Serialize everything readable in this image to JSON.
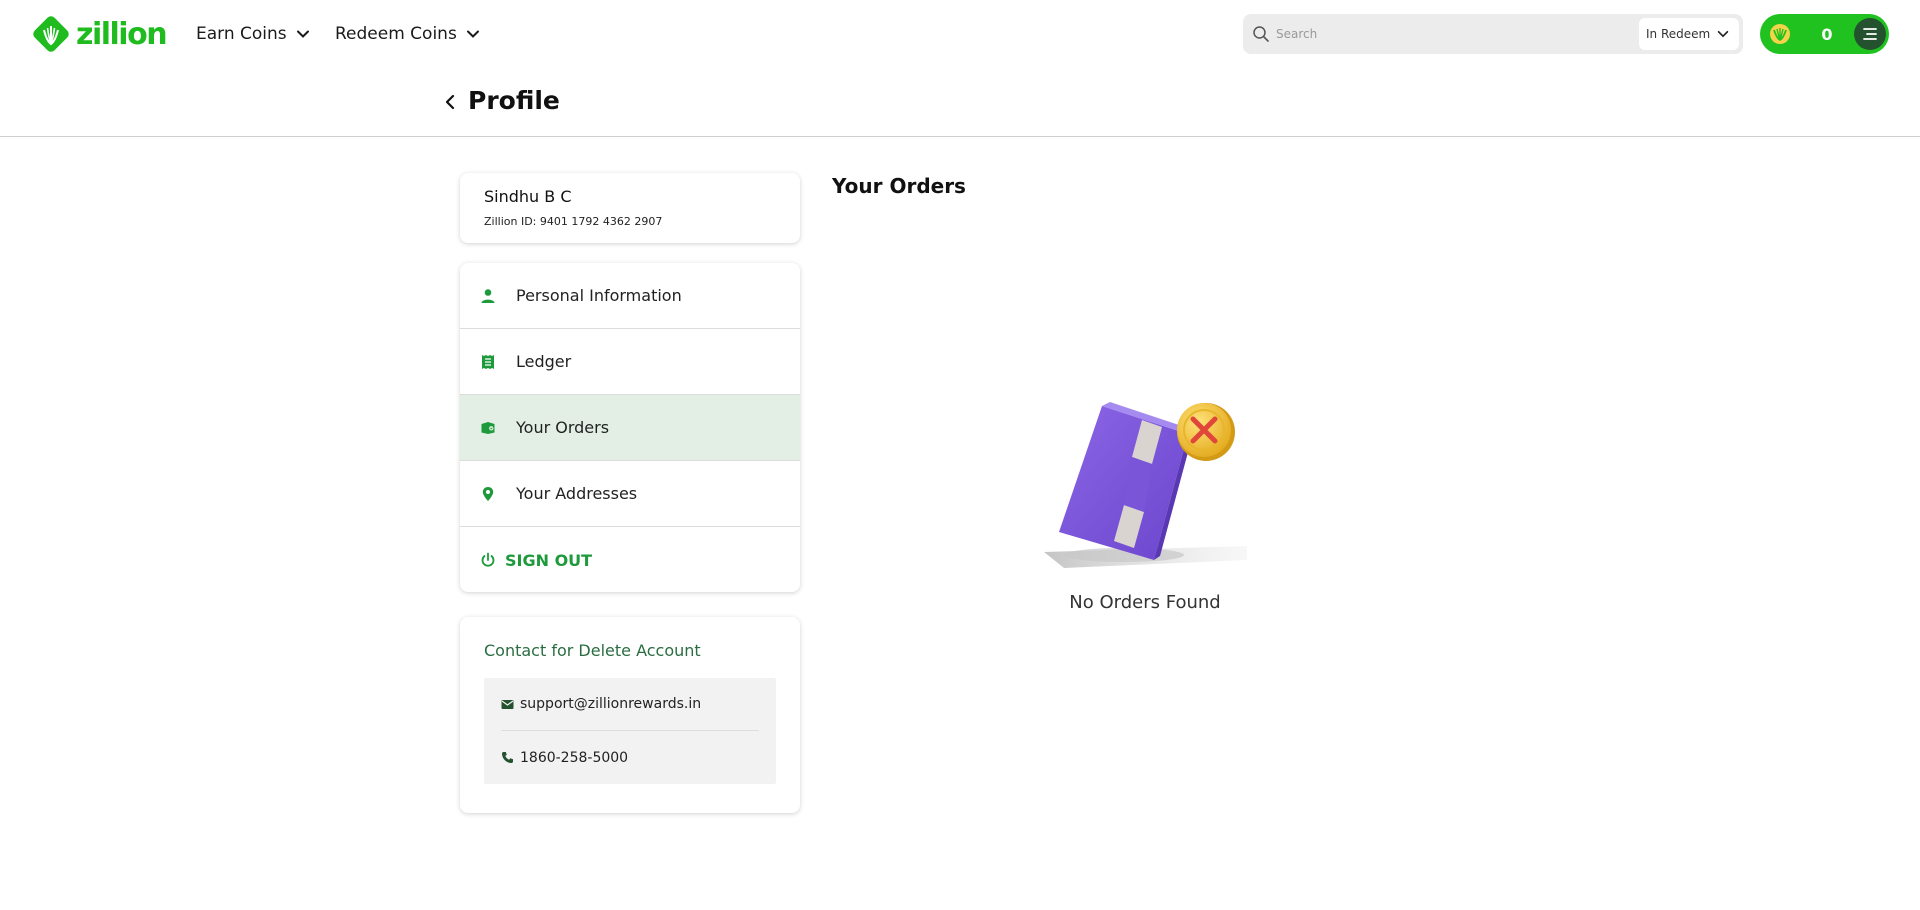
{
  "brand": {
    "name": "zillion",
    "color": "#1fbb1f"
  },
  "nav": {
    "earn_label": "Earn Coins",
    "redeem_label": "Redeem Coins"
  },
  "search": {
    "placeholder": "Search",
    "value": "",
    "scope": "In Redeem"
  },
  "wallet": {
    "coins": "0"
  },
  "page": {
    "title": "Profile"
  },
  "user": {
    "name": "Sindhu B C",
    "zillion_id": "Zillion ID: 9401 1792 4362 2907"
  },
  "menu": {
    "items": [
      {
        "label": "Personal Information",
        "icon": "person-icon"
      },
      {
        "label": "Ledger",
        "icon": "receipt-icon"
      },
      {
        "label": "Your Orders",
        "icon": "orders-icon",
        "active": true
      },
      {
        "label": "Your Addresses",
        "icon": "location-pin-icon"
      }
    ],
    "signout_label": "SIGN OUT"
  },
  "contact": {
    "title": "Contact for Delete Account",
    "email": "support@zillionrewards.in",
    "phone": "1860-258-5000"
  },
  "orders": {
    "title": "Your Orders",
    "empty_text": "No Orders Found"
  },
  "colors": {
    "accent_green": "#1fc21f",
    "menu_icon_green": "#1e9a3c",
    "active_row_bg": "#e3efe4",
    "contact_title": "#2a6d41",
    "box_purple": "#7d57d9",
    "coin_gold": "#f2c230",
    "cross_red": "#e0473a"
  }
}
